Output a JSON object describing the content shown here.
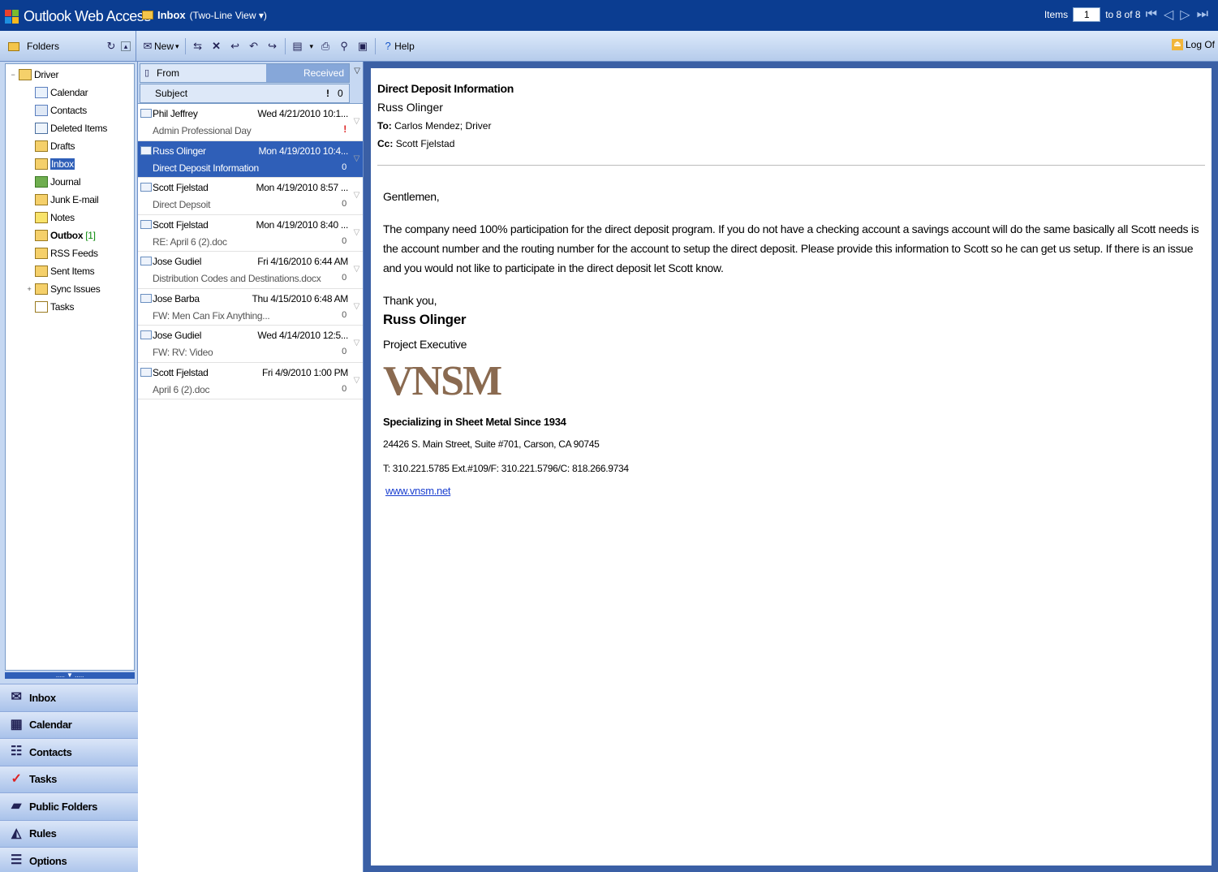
{
  "app": {
    "title": "Outlook Web Access"
  },
  "folder_view": {
    "name": "Inbox",
    "view": "(Two-Line View ▾)"
  },
  "paging": {
    "items_label": "Items",
    "current": "1",
    "range": "to 8 of 8"
  },
  "toolbar": {
    "folders_label": "Folders",
    "new_label": "New",
    "help_label": "Help",
    "logoff_label": "Log Of"
  },
  "folders": [
    {
      "label": "Driver",
      "toggle": "−"
    },
    {
      "label": "Calendar"
    },
    {
      "label": "Contacts"
    },
    {
      "label": "Deleted Items"
    },
    {
      "label": "Drafts"
    },
    {
      "label": "Inbox"
    },
    {
      "label": "Journal"
    },
    {
      "label": "Junk E-mail"
    },
    {
      "label": "Notes"
    },
    {
      "label": "Outbox",
      "count": "[1]"
    },
    {
      "label": "RSS Feeds"
    },
    {
      "label": "Sent Items"
    },
    {
      "label": "Sync Issues",
      "toggle": "+"
    },
    {
      "label": "Tasks"
    }
  ],
  "nav": [
    "Inbox",
    "Calendar",
    "Contacts",
    "Tasks",
    "Public Folders",
    "Rules",
    "Options"
  ],
  "list_headers": {
    "from": "From",
    "received": "Received",
    "subject": "Subject"
  },
  "messages": [
    {
      "from": "Phil Jeffrey",
      "date": "Wed 4/21/2010 10:1...",
      "subject": "Admin Professional Day",
      "important": "!"
    },
    {
      "from": "Russ Olinger",
      "date": "Mon 4/19/2010 10:4...",
      "subject": "Direct Deposit Information",
      "attachment": "0"
    },
    {
      "from": "Scott Fjelstad",
      "date": "Mon 4/19/2010 8:57 ...",
      "subject": "Direct Depsoit",
      "attachment": "0"
    },
    {
      "from": "Scott Fjelstad",
      "date": "Mon 4/19/2010 8:40 ...",
      "subject": "RE: April 6 (2).doc",
      "attachment": "0"
    },
    {
      "from": "Jose Gudiel",
      "date": "Fri 4/16/2010 6:44 AM",
      "subject": "Distribution Codes and Destinations.docx",
      "attachment": "0"
    },
    {
      "from": "Jose Barba",
      "date": "Thu 4/15/2010 6:48 AM",
      "subject": "FW: Men Can Fix Anything...",
      "attachment": "0"
    },
    {
      "from": "Jose Gudiel",
      "date": "Wed 4/14/2010 12:5...",
      "subject": "FW: RV: Video",
      "attachment": "0"
    },
    {
      "from": "Scott Fjelstad",
      "date": "Fri 4/9/2010 1:00 PM",
      "subject": "April 6 (2).doc",
      "attachment": "0"
    }
  ],
  "reading": {
    "subject": "Direct Deposit Information",
    "from": "Russ Olinger",
    "to_label": "To:",
    "to": "Carlos Mendez; Driver",
    "cc_label": "Cc:",
    "cc": "Scott Fjelstad",
    "greeting": "Gentlemen,",
    "body": "The company need 100% participation for the direct deposit program. If you do not have a checking account a savings account will do the same basically all Scott needs is the account number and the routing number for the account to setup the direct deposit. Please provide this information to Scott so he can get us setup. If there is an issue and you would not like to participate in the direct deposit let Scott know.",
    "closing": "Thank you,",
    "sig_name": "Russ Olinger",
    "sig_title": "Project Executive",
    "logo_text": "VNSM",
    "tagline": "Specializing in Sheet Metal Since 1934",
    "address": "24426 S. Main Street, Suite #701, Carson, CA 90745",
    "phone": "T: 310.221.5785 Ext.#109/F: 310.221.5796/C: 818.266.9734",
    "website": "www.vnsm.net"
  },
  "colors": {
    "header": "#0b3d91",
    "selection": "#2f5fb8",
    "logo": "#8a6a50",
    "link": "#1a3fd0"
  }
}
